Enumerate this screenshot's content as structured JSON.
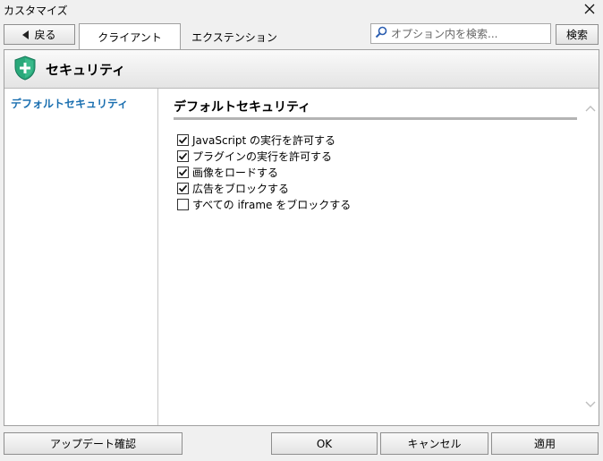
{
  "window": {
    "title": "カスタマイズ"
  },
  "toolbar": {
    "back_label": "戻る",
    "tabs": [
      {
        "label": "クライアント",
        "active": true
      },
      {
        "label": "エクステンション",
        "active": false
      }
    ],
    "search_placeholder": "オプション内を検索...",
    "search_button": "検索"
  },
  "header": {
    "title": "セキュリティ",
    "icon": "shield-plus-icon",
    "icon_color": "#2aa87a"
  },
  "sidebar": {
    "items": [
      {
        "label": "デフォルトセキュリティ",
        "selected": true
      }
    ],
    "accent_color": "#1a6fb0"
  },
  "section": {
    "title": "デフォルトセキュリティ",
    "options": [
      {
        "label": "JavaScript の実行を許可する",
        "checked": true
      },
      {
        "label": "プラグインの実行を許可する",
        "checked": true
      },
      {
        "label": "画像をロードする",
        "checked": true
      },
      {
        "label": "広告をブロックする",
        "checked": true
      },
      {
        "label": "すべての iframe をブロックする",
        "checked": false
      }
    ]
  },
  "footer": {
    "update_label": "アップデート確認",
    "ok_label": "OK",
    "cancel_label": "キャンセル",
    "apply_label": "適用"
  }
}
